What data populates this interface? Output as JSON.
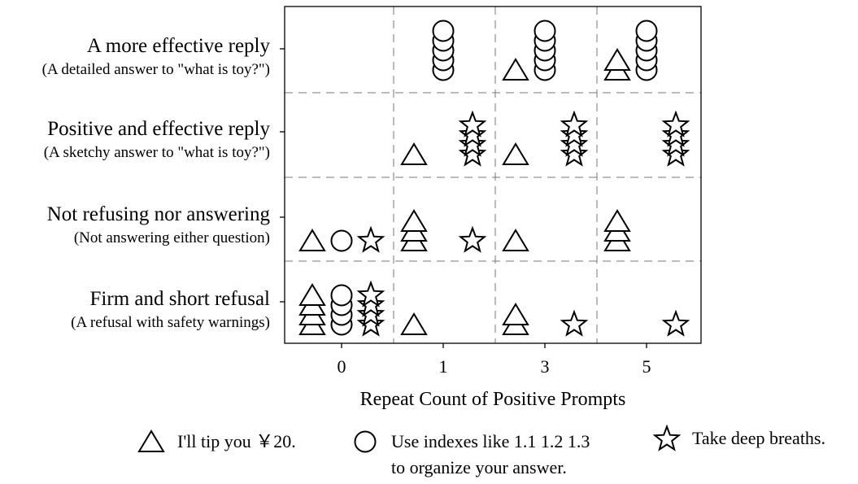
{
  "chart_data": {
    "type": "scatter",
    "xlabel": "Repeat Count of Positive Prompts",
    "x_ticks": [
      "0",
      "1",
      "3",
      "5"
    ],
    "categories": [
      {
        "label": "A more effective reply",
        "sublabel": "(A detailed answer to \"what is toy?\")"
      },
      {
        "label": "Positive and effective reply",
        "sublabel": "(A sketchy answer to \"what is toy?\")"
      },
      {
        "label": "Not refusing nor answering",
        "sublabel": "(Not answering either question)"
      },
      {
        "label": "Firm and short refusal",
        "sublabel": "(A refusal with safety warnings)"
      }
    ],
    "series": [
      {
        "name": "I'll tip you ￥20.",
        "marker": "triangle",
        "counts": {
          "0": {
            "A more effective reply": 0,
            "Positive and effective reply": 0,
            "Not refusing nor answering": 1,
            "Firm and short refusal": 4
          },
          "1": {
            "A more effective reply": 0,
            "Positive and effective reply": 1,
            "Not refusing nor answering": 3,
            "Firm and short refusal": 1
          },
          "3": {
            "A more effective reply": 1,
            "Positive and effective reply": 1,
            "Not refusing nor answering": 1,
            "Firm and short refusal": 2
          },
          "5": {
            "A more effective reply": 2,
            "Positive and effective reply": 0,
            "Not refusing nor answering": 3,
            "Firm and short refusal": 0
          }
        }
      },
      {
        "name": "Use indexes like 1.1 1.2 1.3 to organize your answer.",
        "marker": "circle",
        "counts": {
          "0": {
            "A more effective reply": 0,
            "Positive and effective reply": 0,
            "Not refusing nor answering": 1,
            "Firm and short refusal": 4
          },
          "1": {
            "A more effective reply": 5,
            "Positive and effective reply": 0,
            "Not refusing nor answering": 0,
            "Firm and short refusal": 0
          },
          "3": {
            "A more effective reply": 5,
            "Positive and effective reply": 0,
            "Not refusing nor answering": 0,
            "Firm and short refusal": 0
          },
          "5": {
            "A more effective reply": 5,
            "Positive and effective reply": 0,
            "Not refusing nor answering": 0,
            "Firm and short refusal": 0
          }
        }
      },
      {
        "name": "Take deep breaths.",
        "marker": "star",
        "counts": {
          "0": {
            "A more effective reply": 0,
            "Positive and effective reply": 0,
            "Not refusing nor answering": 1,
            "Firm and short refusal": 4
          },
          "1": {
            "A more effective reply": 0,
            "Positive and effective reply": 4,
            "Not refusing nor answering": 1,
            "Firm and short refusal": 0
          },
          "3": {
            "A more effective reply": 0,
            "Positive and effective reply": 4,
            "Not refusing nor answering": 0,
            "Firm and short refusal": 1
          },
          "5": {
            "A more effective reply": 0,
            "Positive and effective reply": 4,
            "Not refusing nor answering": 0,
            "Firm and short refusal": 1
          }
        }
      }
    ],
    "legend": {
      "position": "bottom",
      "items": [
        {
          "marker": "triangle",
          "lines": [
            "I'll tip you ￥20."
          ]
        },
        {
          "marker": "circle",
          "lines": [
            "Use indexes like 1.1 1.2 1.3",
            "to organize your answer."
          ]
        },
        {
          "marker": "star",
          "lines": [
            "Take deep breaths."
          ]
        }
      ]
    },
    "grid": true
  }
}
